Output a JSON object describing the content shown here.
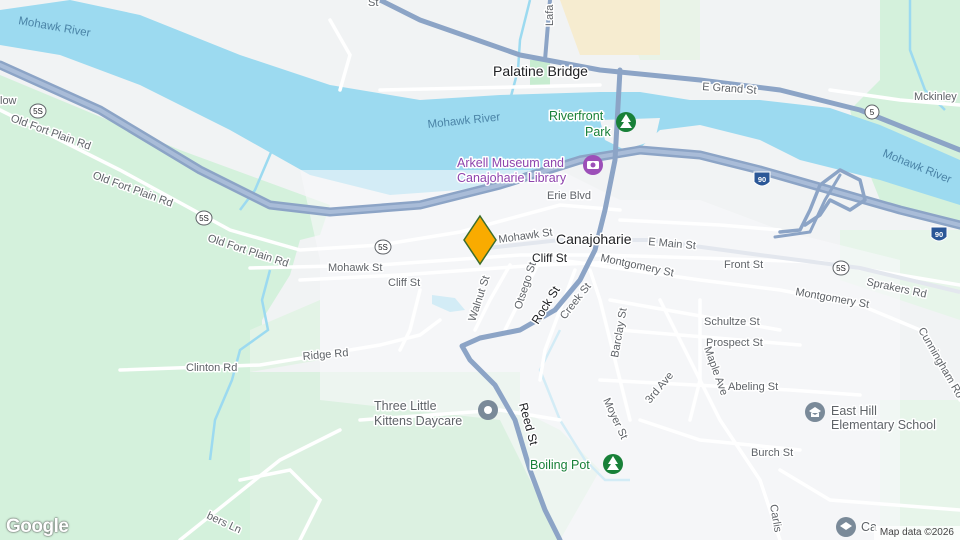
{
  "map": {
    "attribution": "Map data ©2026",
    "logo": "Google",
    "town_labels": {
      "palatine_bridge": "Palatine Bridge",
      "canajoharie": "Canajoharie"
    },
    "water_labels": {
      "mohawk_river_west": "Mohawk River",
      "mohawk_river_mid": "Mohawk River",
      "mohawk_river_east": "Mohawk River"
    },
    "road_labels": {
      "e_grand": "E Grand St",
      "mckinley": "Mckinley",
      "lafa": "Lafa",
      "erie_blvd": "Erie Blvd",
      "mohawk_st_e": "Mohawk St",
      "mohawk_st_w": "Mohawk St",
      "e_main": "E Main St",
      "cliff_st_e": "Cliff St",
      "cliff_st_w": "Cliff St",
      "old_fort_plain_1": "Old Fort Plain Rd",
      "old_fort_plain_2": "Old Fort Plain Rd",
      "old_fort_plain_3": "Old Fort Plain Rd",
      "low": "low",
      "montgomery_1": "Montgomery St",
      "montgomery_2": "Montgomery St",
      "front_st": "Front St",
      "sprakers": "Sprakers Rd",
      "schultze": "Schultze St",
      "prospect": "Prospect St",
      "abeling": "Abeling St",
      "burch": "Burch St",
      "cunningham": "Cunningham Ro",
      "walnut": "Walnut St",
      "otsego": "Otsego St",
      "rock_st": "Rock St",
      "creek_st": "Creek St",
      "barclay": "Barclay St",
      "third_ave": "3rd Ave",
      "maple": "Maple Ave",
      "moyer": "Moyer St",
      "reed": "Reed St",
      "ridge": "Ridge Rd",
      "clinton": "Clinton Rd",
      "carlis": "Carlis",
      "bers_ln": "bers Ln",
      "top_st": "St"
    },
    "shields": {
      "route_5s_a": "5S",
      "route_5s_b": "5S",
      "route_5s_c": "5S",
      "route_5s_d": "5S",
      "route_5": "5",
      "i90_a": "90",
      "i90_b": "90"
    },
    "pois": {
      "riverfront_park": {
        "line1": "Riverfront",
        "line2": "Park",
        "icon": "tree-icon"
      },
      "arkell": {
        "line1": "Arkell Museum and",
        "line2": "Canajoharie Library",
        "icon": "camera-icon"
      },
      "daycare": {
        "line1": "Three Little",
        "line2": "Kittens Daycare",
        "icon": "pin-icon"
      },
      "east_hill": {
        "line1": "East Hill",
        "line2": "Elementary School",
        "icon": "school-icon"
      },
      "boiling_pot": {
        "line1": "Boiling Pot",
        "icon": "tree-icon"
      },
      "bottom_school": {
        "line1": "Ca",
        "icon": "school-icon"
      }
    },
    "marker": {
      "icon": "map-pin-diamond-icon",
      "color": "#f9ab00"
    },
    "colors": {
      "water": "#9cdaf0",
      "park": "#d4f1dc",
      "highway": "#8ca4c6",
      "road": "#ffffff",
      "land": "#f1f3f4"
    }
  }
}
